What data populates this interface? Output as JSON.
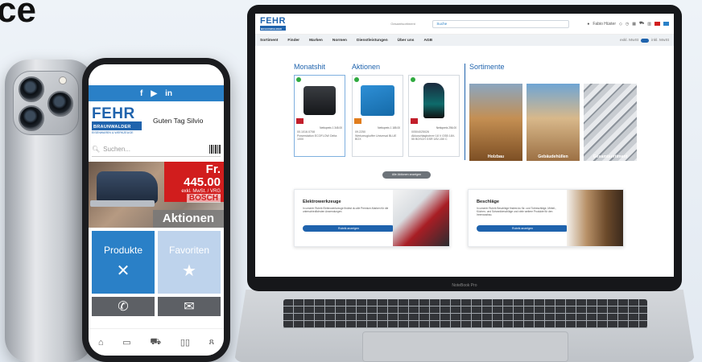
{
  "heading": "ce",
  "phone": {
    "social_icons": [
      "facebook-icon",
      "youtube-icon",
      "linkedin-icon"
    ],
    "social_glyphs": [
      "f",
      "▶",
      "in"
    ],
    "logo": {
      "word": "FEHR",
      "sub": "BRAUNWALDER",
      "tagline": "EISENWAREN & WERKZEUGE"
    },
    "greeting": "Guten Tag Silvio",
    "search_placeholder": "Suchen...",
    "promo": {
      "price": "Fr. 445.00",
      "price_note": "exkl. MwSt. / VRG",
      "old_price": "statt Fr. 690.00",
      "brand": "BOSCH",
      "label": "Aktionen"
    },
    "tiles": [
      {
        "label": "Produkte",
        "icon": "tools-icon"
      },
      {
        "label": "Favoriten",
        "icon": "star-icon"
      }
    ],
    "quick_actions": [
      {
        "icon": "phone-icon",
        "glyph": "✆"
      },
      {
        "icon": "mail-icon",
        "glyph": "✉"
      }
    ],
    "bottom_nav": [
      {
        "icon": "home-icon",
        "glyph": "⌂"
      },
      {
        "icon": "catalog-icon",
        "glyph": "▭"
      },
      {
        "icon": "cart-icon",
        "glyph": "⛟"
      },
      {
        "icon": "book-icon",
        "glyph": "▯▯"
      },
      {
        "icon": "user-icon",
        "glyph": "ጸ"
      }
    ]
  },
  "laptop": {
    "brand_label": "NoteBook Pro",
    "header": {
      "type_selector": "Gesamtsortiment",
      "search_placeholder": "Suche",
      "user_name": "Fabio Hüster"
    },
    "nav": [
      "Sortiment",
      "Finder",
      "Marken",
      "Normen",
      "Dienstleistungen",
      "Über uns",
      "AGB"
    ],
    "nav_right": [
      "exkl. MwSt",
      "inkl. MwSt"
    ],
    "sections": {
      "monatshit": "Monatshit",
      "aktionen": "Aktionen",
      "sortimente": "Sortimente"
    },
    "cards": [
      {
        "code": "Nettopreis 1 345.00",
        "id": "00.1016.0708",
        "text": "Powerstation ECOFLOW Delta 1000",
        "brand": "ECOFLOW"
      },
      {
        "code": "Nettopreis 1 185.00",
        "id": "09.2250",
        "text": "Werkzeugkoffer Universal BLUE BOX",
        "brand": "SORTIMO"
      },
      {
        "code": "Nettopreis 256.00",
        "id": "00504025026",
        "text": "Akkuschlagbohrer 18 V GSB 18V-55 BOSCH GSR 18V-150 C",
        "brand": "BOSCH"
      }
    ],
    "assortments": [
      "Holzbau",
      "Gebäudehüllen",
      "Gesamtsortiment"
    ],
    "show_all": "Alle Aktionen anzeigen",
    "banners": [
      {
        "title": "Elektrowerkzeuge",
        "desc": "In unserer Rubrik Elektrowerkzeuge findest du alle Premium-Marken für die unterschiedlichsten Anwendungen.",
        "button": "Rubrik anzeigen"
      },
      {
        "title": "Beschläge",
        "desc": "In unserer Rubrik Beschläge findest du für- und Torbeschläge, Möbel-, Küchen- und Schrankbeschläge und viele weitere Produkte für den Innenausbau.",
        "button": "Rubrik anzeigen"
      }
    ]
  },
  "colors": {
    "brand_blue": "#1f63ad",
    "tile_blue": "#2a80c7",
    "promo_red": "#d11d1d"
  }
}
